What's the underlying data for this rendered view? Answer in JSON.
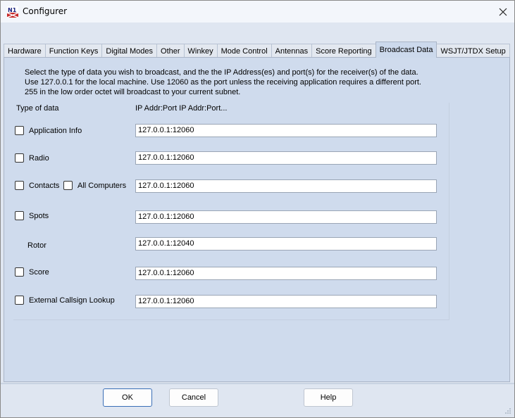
{
  "window": {
    "title": "Configurer",
    "app_icon_text": "N1"
  },
  "tabs": [
    {
      "label": "Hardware"
    },
    {
      "label": "Function Keys"
    },
    {
      "label": "Digital Modes"
    },
    {
      "label": "Other"
    },
    {
      "label": "Winkey"
    },
    {
      "label": "Mode Control"
    },
    {
      "label": "Antennas"
    },
    {
      "label": "Score Reporting"
    },
    {
      "label": "Broadcast Data",
      "active": true
    },
    {
      "label": "WSJT/JTDX Setup"
    }
  ],
  "description": [
    "Select the type of data you wish to broadcast, and the the IP Address(es) and port(s) for the receiver(s) of the data.",
    "Use 127.0.0.1 for the local machine.  Use 12060 as the port unless the receiving application requires a different port.",
    "255 in the low order octet will broadcast to your current subnet."
  ],
  "headers": {
    "type_of_data": "Type of data",
    "ip_addr": "IP Addr:Port IP Addr:Port..."
  },
  "rows": [
    {
      "label": "Application Info",
      "checkbox": true,
      "checked": false,
      "value": "127.0.0.1:12060"
    },
    {
      "label": "Radio",
      "checkbox": true,
      "checked": false,
      "value": "127.0.0.1:12060"
    },
    {
      "label": "Contacts",
      "checkbox": true,
      "checked": false,
      "value": "127.0.0.1:12060",
      "extra_label": "All Computers"
    },
    {
      "label": "Spots",
      "checkbox": true,
      "checked": false,
      "value": "127.0.0.1:12060"
    },
    {
      "label": "Rotor",
      "checkbox": false,
      "value": "127.0.0.1:12040"
    },
    {
      "label": "Score",
      "checkbox": true,
      "checked": false,
      "value": "127.0.0.1:12060"
    },
    {
      "label": "External Callsign Lookup",
      "checkbox": true,
      "checked": false,
      "value": "127.0.0.1:12060"
    }
  ],
  "buttons": {
    "ok": "OK",
    "cancel": "Cancel",
    "help": "Help"
  },
  "colors": {
    "panel_bg": "#cfdbed",
    "window_bg": "#dfe6f1",
    "default_button_border": "#3a6fb7"
  }
}
